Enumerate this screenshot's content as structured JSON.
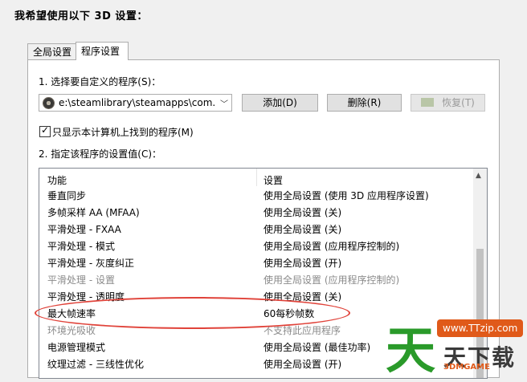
{
  "heading": "我希望使用以下 3D 设置：",
  "tabs": [
    {
      "label": "全局设置",
      "active": false
    },
    {
      "label": "程序设置",
      "active": true
    }
  ],
  "section1_label": "1. 选择要自定义的程序(S)：",
  "program_combo": {
    "value": "e:\\steamlibrary\\steamapps\\com...",
    "arrow": "﹀"
  },
  "buttons": {
    "add": "添加(D)",
    "delete": "删除(R)",
    "restore": "恢复(T)"
  },
  "checkbox": {
    "label": "只显示本计算机上找到的程序(M)",
    "checked": true,
    "mark": "✓"
  },
  "section2_label": "2. 指定该程序的设置值(C)：",
  "table": {
    "headers": [
      "功能",
      "设置"
    ],
    "rows": [
      {
        "feature": "垂直同步",
        "setting": "使用全局设置 (使用 3D 应用程序设置)",
        "disabled": false
      },
      {
        "feature": "多帧采样 AA (MFAA)",
        "setting": "使用全局设置 (关)",
        "disabled": false
      },
      {
        "feature": "平滑处理 - FXAA",
        "setting": "使用全局设置 (关)",
        "disabled": false
      },
      {
        "feature": "平滑处理 - 模式",
        "setting": "使用全局设置 (应用程序控制的)",
        "disabled": false
      },
      {
        "feature": "平滑处理 - 灰度纠正",
        "setting": "使用全局设置 (开)",
        "disabled": false
      },
      {
        "feature": "平滑处理 - 设置",
        "setting": "使用全局设置 (应用程序控制的)",
        "disabled": true
      },
      {
        "feature": "平滑处理 - 透明度",
        "setting": "使用全局设置 (关)",
        "disabled": false
      },
      {
        "feature": "最大帧速率",
        "setting": "60每秒帧数",
        "disabled": false
      },
      {
        "feature": "环境光吸收",
        "setting": "不支持此应用程序",
        "disabled": true
      },
      {
        "feature": "电源管理模式",
        "setting": "使用全局设置 (最佳功率)",
        "disabled": false
      },
      {
        "feature": "纹理过滤 - 三线性优化",
        "setting": "使用全局设置 (开)",
        "disabled": false
      }
    ]
  },
  "watermark": {
    "big": "天",
    "url": "www.TTzip.com",
    "mid": "天下载",
    "small": "3DMGAME"
  },
  "colors": {
    "highlight_ellipse": "#e0433a",
    "watermark_green": "#2a9a2a",
    "watermark_orange": "#e05a1a"
  }
}
